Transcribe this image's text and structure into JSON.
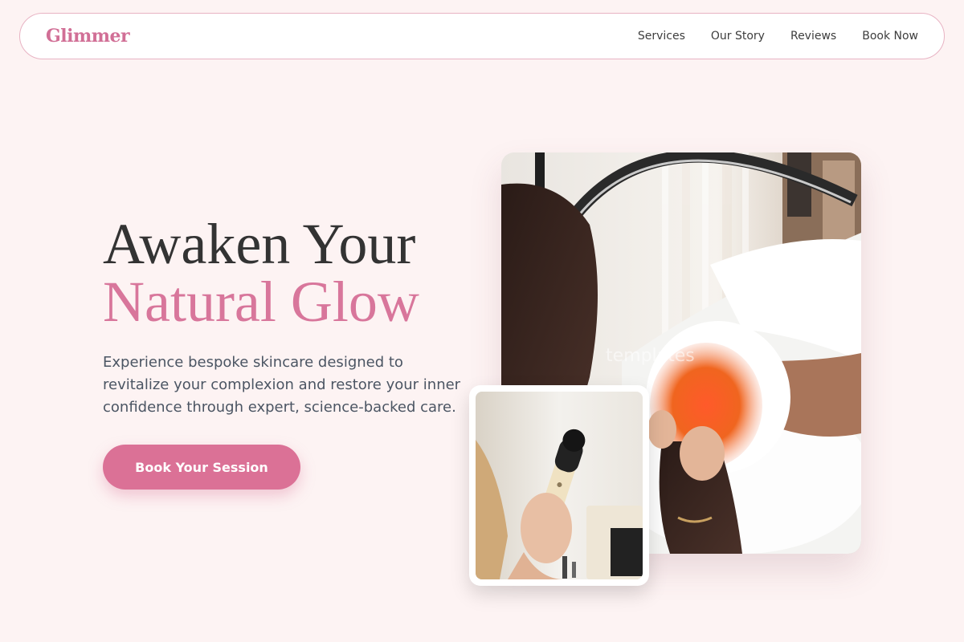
{
  "nav": {
    "brand": "Glimmer",
    "links": [
      "Services",
      "Our Story",
      "Reviews",
      "Book Now"
    ]
  },
  "hero": {
    "title_line1": "Awaken Your",
    "title_line2": "Natural Glow",
    "subtitle": "Experience bespoke skincare designed to revitalize your complexion and restore your inner confidence through expert, science-backed care.",
    "cta_label": "Book Your Session"
  },
  "images": {
    "main_watermark": "templates"
  },
  "colors": {
    "background": "#fdf3f3",
    "accent": "#d8769b",
    "button": "#db7196",
    "heading": "#333333",
    "body_text": "#4b5563"
  }
}
